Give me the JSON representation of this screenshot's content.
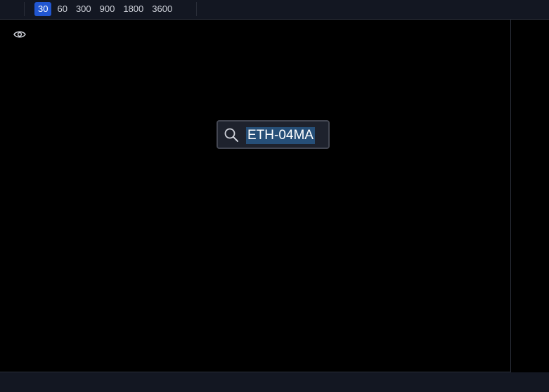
{
  "toolbar": {
    "intervals": [
      {
        "label": "30",
        "active": true
      },
      {
        "label": "60",
        "active": false
      },
      {
        "label": "300",
        "active": false
      },
      {
        "label": "900",
        "active": false
      },
      {
        "label": "1800",
        "active": false
      },
      {
        "label": "3600",
        "active": false
      }
    ],
    "active_color": "#2156d1"
  },
  "chart": {
    "visibility_icon": "eye-icon"
  },
  "symbol_search": {
    "icon": "search-icon",
    "value": "ETH-04MA"
  }
}
